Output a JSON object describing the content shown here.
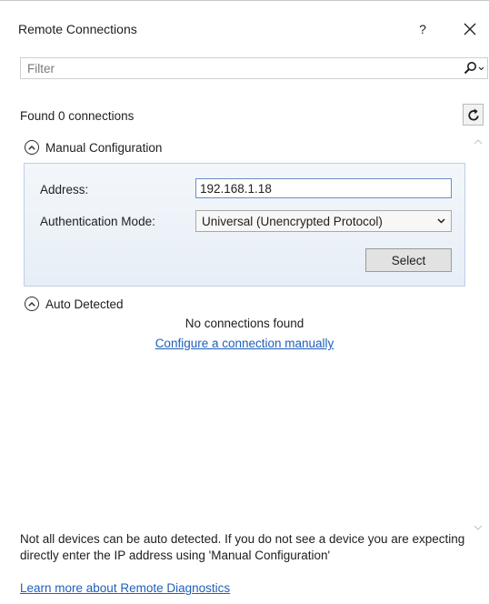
{
  "window": {
    "title": "Remote Connections",
    "help_label": "?"
  },
  "filter": {
    "placeholder": "Filter",
    "value": ""
  },
  "status": {
    "found_text": "Found 0 connections"
  },
  "manual_config": {
    "header_label": "Manual Configuration",
    "address_label": "Address:",
    "address_value": "192.168.1.18",
    "auth_label": "Authentication Mode:",
    "auth_selected": "Universal (Unencrypted Protocol)",
    "select_button_label": "Select"
  },
  "auto_detected": {
    "header_label": "Auto Detected",
    "empty_text": "No connections found",
    "configure_link": "Configure a connection manually"
  },
  "footer": {
    "note": "Not all devices can be auto detected. If you do not see a device you are expecting directly enter the IP address using 'Manual Configuration'",
    "learn_more_link": "Learn more about Remote Diagnostics"
  },
  "icons": {
    "help": "question-mark",
    "close": "close-x",
    "search": "magnifier-with-dropdown",
    "refresh": "refresh-arrow",
    "collapse": "chevron-up-in-circle",
    "dropdown": "chevron-down",
    "scroll_up": "chevron-up",
    "scroll_down": "chevron-down"
  },
  "colors": {
    "link": "#1f5fb9",
    "panel_border": "#bcd0e4",
    "input_focus_border": "#6b8fc7"
  }
}
